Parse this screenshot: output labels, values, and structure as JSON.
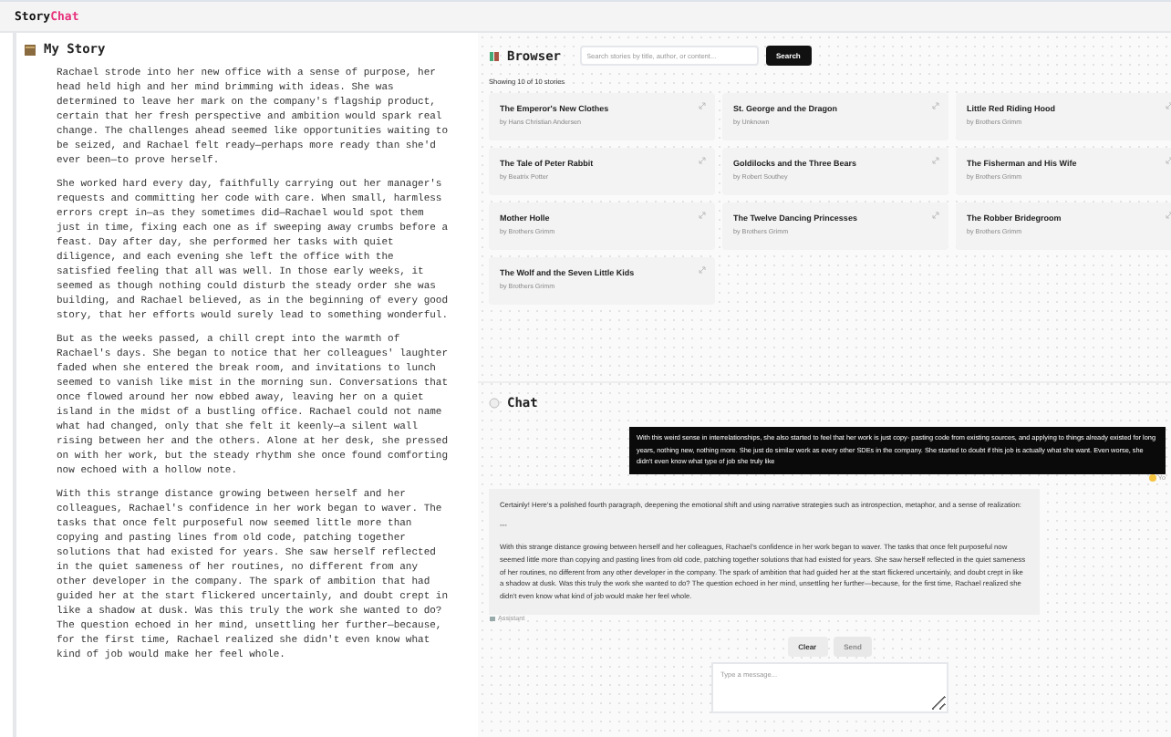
{
  "app": {
    "title_parts": [
      "Story",
      "Chat"
    ]
  },
  "story": {
    "title": "My Story",
    "paragraphs": [
      "Rachael strode into her new office with a sense of purpose, her head held high and her mind brimming with ideas. She was determined to leave her mark on the company's flagship product, certain that her fresh perspective and ambition would spark real change. The challenges ahead seemed like opportunities waiting to be seized, and Rachael felt ready—perhaps more ready than she'd ever been—to prove herself.",
      "She worked hard every day, faithfully carrying out her manager's requests and committing her code with care. When small, harmless errors crept in—as they sometimes did—Rachael would spot them just in time, fixing each one as if sweeping away crumbs before a feast. Day after day, she performed her tasks with quiet diligence, and each evening she left the office with the satisfied feeling that all was well. In those early weeks, it seemed as though nothing could disturb the steady order she was building, and Rachael believed, as in the beginning of every good story, that her efforts would surely lead to something wonderful.",
      "But as the weeks passed, a chill crept into the warmth of Rachael's days. She began to notice that her colleagues' laughter faded when she entered the break room, and invitations to lunch seemed to vanish like mist in the morning sun. Conversations that once flowed around her now ebbed away, leaving her on a quiet island in the midst of a bustling office. Rachael could not name what had changed, only that she felt it keenly—a silent wall rising between her and the others. Alone at her desk, she pressed on with her work, but the steady rhythm she once found comforting now echoed with a hollow note.",
      "With this strange distance growing between herself and her colleagues, Rachael's confidence in her work began to waver. The tasks that once felt purposeful now seemed little more than copying and pasting lines from old code, patching together solutions that had existed for years. She saw herself reflected in the quiet sameness of her routines, no different from any other developer in the company. The spark of ambition that had guided her at the start flickered uncertainly, and doubt crept in like a shadow at dusk. Was this truly the work she wanted to do? The question echoed in her mind, unsettling her further—because, for the first time, Rachael realized she didn't even know what kind of job would make her feel whole."
    ]
  },
  "browser": {
    "title": "Browser",
    "search": {
      "placeholder": "Search stories by title, author, or content..."
    },
    "search_button": "Search",
    "count": "Showing 10 of 10 stories",
    "stories": [
      {
        "title": "The Emperor's New Clothes",
        "author": "by Hans Christian Andersen"
      },
      {
        "title": "St. George and the Dragon",
        "author": "by Unknown"
      },
      {
        "title": "Little Red Riding Hood",
        "author": "by Brothers Grimm"
      },
      {
        "title": "The Tale of Peter Rabbit",
        "author": "by Beatrix Potter"
      },
      {
        "title": "Goldilocks and the Three Bears",
        "author": "by Robert Southey"
      },
      {
        "title": "The Fisherman and His Wife",
        "author": "by Brothers Grimm"
      },
      {
        "title": "Mother Holle",
        "author": "by Brothers Grimm"
      },
      {
        "title": "The Twelve Dancing Princesses",
        "author": "by Brothers Grimm"
      },
      {
        "title": "The Robber Bridegroom",
        "author": "by Brothers Grimm"
      },
      {
        "title": "The Wolf and the Seven Little Kids",
        "author": "by Brothers Grimm"
      }
    ]
  },
  "chat": {
    "title": "Chat",
    "messages": [
      {
        "kind": "user",
        "sender": "Yo",
        "paragraphs": [
          "With this weird sense in interrelationships, she also started to feel that her work is just copy- pasting code from existing sources, and applying to things already existed for long years, nothing new, nothing more. She just do similar work as every other SDEs in the company. She started to doubt if this job is actually what she want. Even worse, she didn't even know what type of job she truly like"
        ]
      },
      {
        "kind": "assistant",
        "sender": "Assistant",
        "paragraphs": [
          "Certainly! Here's a polished fourth paragraph, deepening the emotional shift and using narrative strategies such as introspection, metaphor, and a sense of realization:",
          "---",
          "With this strange distance growing between herself and her colleagues, Rachael's confidence in her work began to waver. The tasks that once felt purposeful now seemed little more than copying and pasting lines from old code, patching together solutions that had existed for years. She saw herself reflected in the quiet sameness of her routines, no different from any other developer in the company. The spark of ambition that had guided her at the start flickered uncertainly, and doubt crept in like a shadow at dusk. Was this truly the work she wanted to do? The question echoed in her mind, unsettling her further—because, for the first time, Rachael realized she didn't even know what kind of job would make her feel whole."
        ]
      }
    ],
    "clear_button": {
      "label": "Clear",
      "disabled": false
    },
    "send_button": {
      "label": "Send",
      "disabled": true
    },
    "input": {
      "placeholder": "Type a message..."
    }
  }
}
